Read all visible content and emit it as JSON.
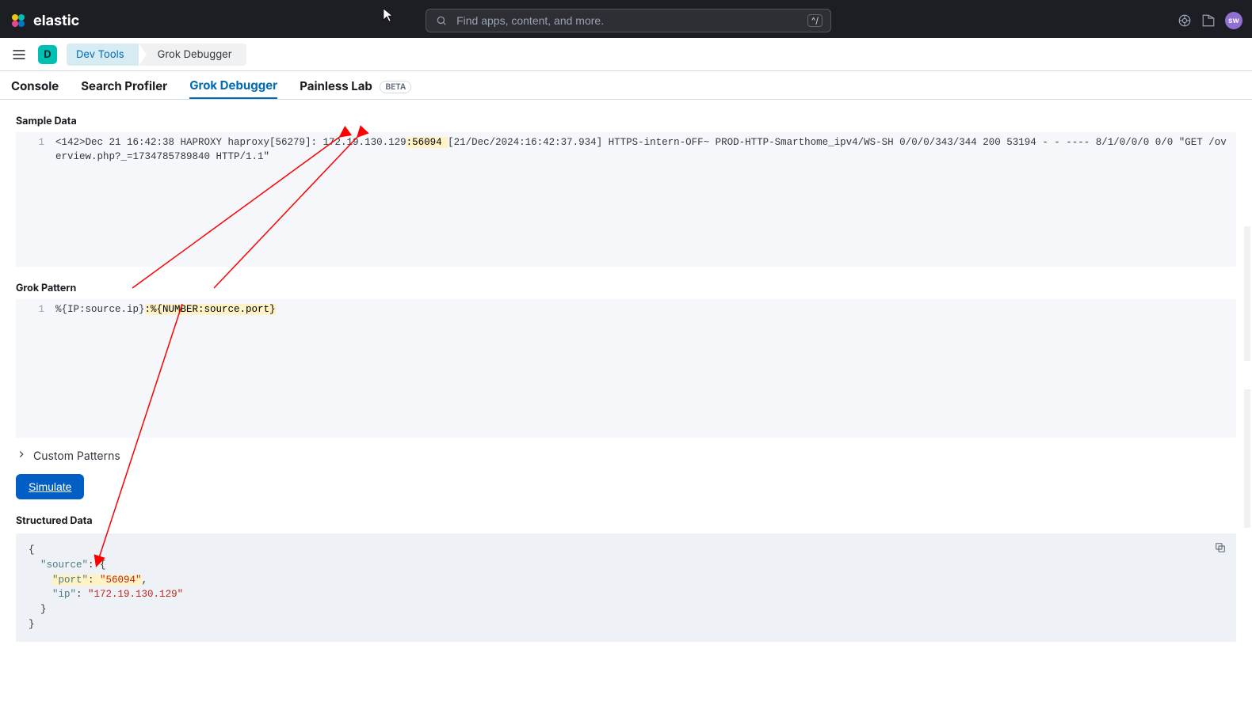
{
  "brand": "elastic",
  "search": {
    "placeholder": "Find apps, content, and more.",
    "kbd": "^/"
  },
  "avatar": "sw",
  "space_badge": "D",
  "breadcrumb": {
    "first": "Dev Tools",
    "second": "Grok Debugger"
  },
  "tabs": {
    "console": "Console",
    "profiler": "Search Profiler",
    "grok": "Grok Debugger",
    "painless": "Painless Lab",
    "beta": "BETA"
  },
  "labels": {
    "sample": "Sample Data",
    "pattern": "Grok Pattern",
    "custom": "Custom Patterns",
    "simulate": "Simulate",
    "structured": "Structured Data"
  },
  "sample_data": {
    "line_no": "1",
    "pre": "<142>Dec 21 16:42:38 HAPROXY haproxy[56279]: 172.19.130.129",
    "hl": ":56094 ",
    "post": "[21/Dec/2024:16:42:37.934] HTTPS-intern-OFF~ PROD-HTTP-Smarthome_ipv4/WS-SH 0/0/0/343/344 200 53194 - - ---- 8/1/0/0/0 0/0 \"GET /overview.php?_=1734785789840 HTTP/1.1\""
  },
  "pattern": {
    "line_no": "1",
    "pre": "%{IP:source.ip}",
    "hl": ":%{NUMBER:source.port}"
  },
  "structured": {
    "source_key": "\"source\"",
    "port_key": "\"port\"",
    "port_val": "\"56094\"",
    "ip_key": "\"ip\"",
    "ip_val": "\"172.19.130.129\""
  }
}
